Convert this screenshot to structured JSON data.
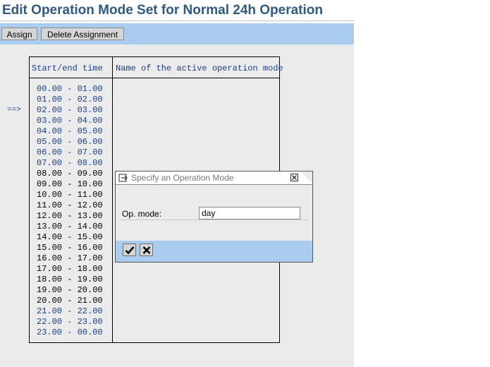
{
  "header": {
    "title": "Edit Operation Mode Set for Normal 24h Operation"
  },
  "toolbar": {
    "assign_label": "Assign",
    "delete_label": "Delete Assignment"
  },
  "table": {
    "col_time": "Start/end time",
    "col_mode": "Name of the active operation mode",
    "marker": "==>",
    "rows": [
      "00.00 - 01.00",
      "01.00 - 02.00",
      "02.00 - 03.00",
      "03.00 - 04.00",
      "04.00 - 05.00",
      "05.00 - 06.00",
      "06.00 - 07.00",
      "07.00 - 08.00",
      "08.00 - 09.00",
      "09.00 - 10.00",
      "10.00 - 11.00",
      "11.00 - 12.00",
      "12.00 - 13.00",
      "13.00 - 14.00",
      "14.00 - 15.00",
      "15.00 - 16.00",
      "16.00 - 17.00",
      "17.00 - 18.00",
      "18.00 - 19.00",
      "19.00 - 20.00",
      "20.00 - 21.00",
      "21.00 - 22.00",
      "22.00 - 23.00",
      "23.00 - 00.00"
    ],
    "blue_rows": [
      0,
      1,
      2,
      3,
      4,
      5,
      6,
      7,
      21,
      22,
      23
    ]
  },
  "dialog": {
    "title": "Specify an Operation Mode",
    "field_label": "Op. mode:",
    "field_value": "day",
    "icons": {
      "window": "dialog-window-icon",
      "close": "close-icon",
      "ok": "checkmark-icon",
      "cancel": "cancel-x-icon"
    }
  },
  "colors": {
    "title": "#2e5a84",
    "toolbar": "#a9ccef",
    "background": "#ebebeb",
    "link_text": "#1a3f8a"
  }
}
